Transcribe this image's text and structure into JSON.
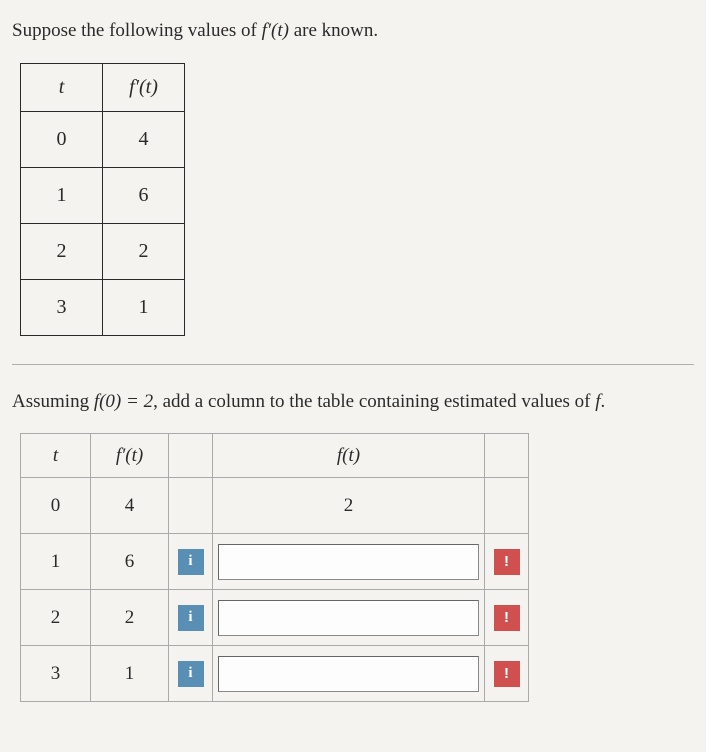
{
  "intro1_pre": "Suppose the following values of ",
  "intro1_func": "f′(t)",
  "intro1_post": " are known.",
  "table1": {
    "head_t": "t",
    "head_fp": "f′(t)",
    "rows": [
      {
        "t": "0",
        "fp": "4"
      },
      {
        "t": "1",
        "fp": "6"
      },
      {
        "t": "2",
        "fp": "2"
      },
      {
        "t": "3",
        "fp": "1"
      }
    ]
  },
  "intro2_pre": "Assuming ",
  "intro2_cond": "f(0) = 2",
  "intro2_post1": ", add a column to the table containing estimated values of ",
  "intro2_fvar": "f",
  "intro2_post2": ".",
  "table2": {
    "head_t": "t",
    "head_fp": "f′(t)",
    "head_ft": "f(t)",
    "row0": {
      "t": "0",
      "fp": "4",
      "ft": "2"
    },
    "rows": [
      {
        "t": "1",
        "fp": "6",
        "val": ""
      },
      {
        "t": "2",
        "fp": "2",
        "val": ""
      },
      {
        "t": "3",
        "fp": "1",
        "val": ""
      }
    ]
  },
  "info_label": "i",
  "warn_label": "!"
}
